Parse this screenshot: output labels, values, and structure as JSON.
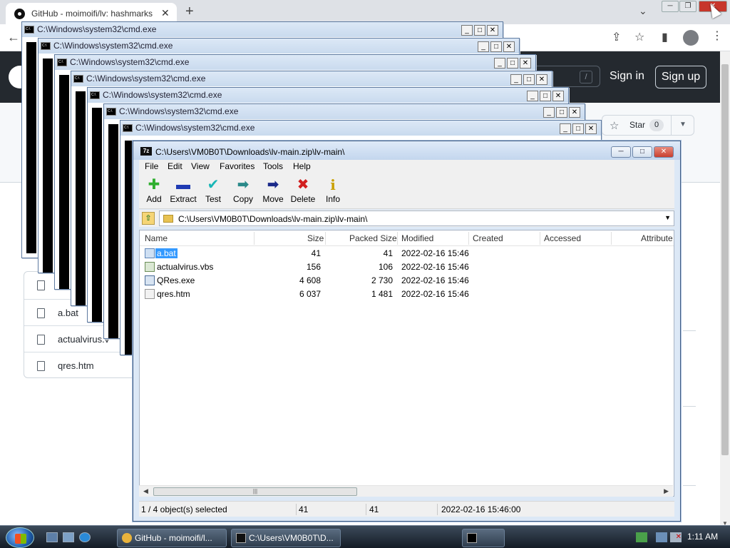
{
  "browser": {
    "tab_title": "GitHub - moimoifi/lv: hashmarks",
    "new_tab": "+",
    "close_tab": "✕",
    "github": {
      "sign_in": "Sign in",
      "sign_up": "Sign up",
      "search_slash": "/",
      "star_label": "Star",
      "star_count": "0",
      "files": [
        "a.bat",
        "actualvirus.v",
        "qres.htm"
      ]
    }
  },
  "cmd_windows": {
    "title": "C:\\Windows\\system32\\cmd.exe",
    "btn_min": "_",
    "btn_max": "□",
    "btn_close": "✕"
  },
  "sevenzip": {
    "title": "C:\\Users\\VM0B0T\\Downloads\\lv-main.zip\\lv-main\\",
    "menu": [
      "File",
      "Edit",
      "View",
      "Favorites",
      "Tools",
      "Help"
    ],
    "toolbar": [
      {
        "label": "Add",
        "icon": "plus-icon",
        "glyph": "✚",
        "color": "#2fae2f"
      },
      {
        "label": "Extract",
        "icon": "minus-icon",
        "glyph": "▬",
        "color": "#1f3bb3"
      },
      {
        "label": "Test",
        "icon": "check-icon",
        "glyph": "✔",
        "color": "#19b6b6"
      },
      {
        "label": "Copy",
        "icon": "copy-arrow-icon",
        "glyph": "➡",
        "color": "#2a8a8a"
      },
      {
        "label": "Move",
        "icon": "move-arrow-icon",
        "glyph": "➡",
        "color": "#1a2a8a"
      },
      {
        "label": "Delete",
        "icon": "delete-x-icon",
        "glyph": "✖",
        "color": "#d21f1f"
      },
      {
        "label": "Info",
        "icon": "info-icon",
        "glyph": "i",
        "color": "#c9a000"
      }
    ],
    "path": "C:\\Users\\VM0B0T\\Downloads\\lv-main.zip\\lv-main\\",
    "columns": [
      "Name",
      "Size",
      "Packed Size",
      "Modified",
      "Created",
      "Accessed",
      "Attribute"
    ],
    "files": [
      {
        "name": "a.bat",
        "size": "41",
        "packed": "41",
        "modified": "2022-02-16 15:46",
        "selected": true
      },
      {
        "name": "actualvirus.vbs",
        "size": "156",
        "packed": "106",
        "modified": "2022-02-16 15:46",
        "selected": false
      },
      {
        "name": "QRes.exe",
        "size": "4 608",
        "packed": "2 730",
        "modified": "2022-02-16 15:46",
        "selected": false
      },
      {
        "name": "qres.htm",
        "size": "6 037",
        "packed": "1 481",
        "modified": "2022-02-16 15:46",
        "selected": false
      }
    ],
    "status": {
      "selection": "1 / 4 object(s) selected",
      "size": "41",
      "packed": "41",
      "modified": "2022-02-16 15:46:00"
    }
  },
  "taskbar": {
    "tasks": [
      "GitHub - moimoifi/l...",
      "C:\\Users\\VM0B0T\\D..."
    ],
    "clock": "1:11 AM"
  }
}
